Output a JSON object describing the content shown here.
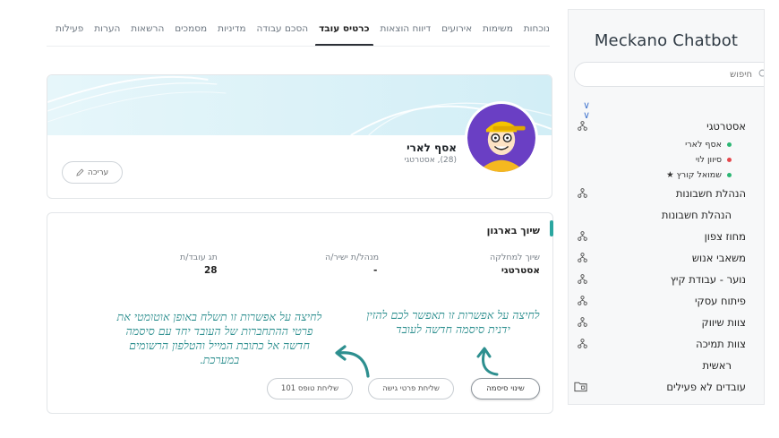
{
  "sidebar": {
    "title": "Meckano Chatbot",
    "search_placeholder": "חיפוש",
    "items": [
      {
        "label": "אסטרטגי",
        "type": "tree"
      },
      {
        "label": "אסף לארי",
        "type": "sub",
        "dot": "green"
      },
      {
        "label": "סיוון לוי",
        "type": "sub",
        "dot": "red"
      },
      {
        "label": "שמואל קורץ ★",
        "type": "sub",
        "dot": "green"
      },
      {
        "label": "הנהלת חשבונות",
        "type": "tree"
      },
      {
        "label": "הנהלת חשבונות",
        "type": "plain"
      },
      {
        "label": "מחוז צפון",
        "type": "tree"
      },
      {
        "label": "משאבי אנוש",
        "type": "tree"
      },
      {
        "label": "נוער - עבודת קיץ",
        "type": "tree"
      },
      {
        "label": "פיתוח עסקי",
        "type": "tree"
      },
      {
        "label": "צוות שיווק",
        "type": "tree"
      },
      {
        "label": "צוות תמיכה",
        "type": "tree"
      },
      {
        "label": "ראשית",
        "type": "plain"
      },
      {
        "label": "עובדים לא פעילים",
        "type": "folder"
      }
    ]
  },
  "tabs": [
    {
      "label": "נוכחות",
      "active": false
    },
    {
      "label": "משימות",
      "active": false
    },
    {
      "label": "אירועים",
      "active": false
    },
    {
      "label": "דיווח הוצאות",
      "active": false
    },
    {
      "label": "כרטיס עובד",
      "active": true
    },
    {
      "label": "הסכם עבודה",
      "active": false
    },
    {
      "label": "מדיניות",
      "active": false
    },
    {
      "label": "מסמכים",
      "active": false
    },
    {
      "label": "הרשאות",
      "active": false
    },
    {
      "label": "הערות",
      "active": false
    },
    {
      "label": "פעילות",
      "active": false
    }
  ],
  "profile": {
    "name": "אסף לארי",
    "subtitle": "(28), אסטרטגי",
    "edit_label": "עריכה"
  },
  "org": {
    "title": "שיוך בארגון",
    "fields": [
      {
        "label": "שיוך למחלקה",
        "value": "אסטרטגי"
      },
      {
        "label": "מנהל/ת ישיר/ה",
        "value": "-"
      },
      {
        "label": "תג עובד/ת",
        "value": "28"
      }
    ],
    "buttons": {
      "change_password": "שינוי סיסמה",
      "send_access": "שליחת פרטי גישה",
      "send_form": "שליחת טופס 101"
    },
    "notes": {
      "right": "לחיצה על אפשרות זו תאפשר לכם להזין ידנית סיסמה חדשה לעובד",
      "left": "לחיצה על אפשרות זו תשלח באופן אוטומטי את פרטי ההתחברות של העובד יחד עם סיסמה חדשה אל כתובת המייל והטלפון הרשומים במערכת."
    }
  },
  "colors": {
    "accent_teal": "#2aa6a0",
    "annotation": "#2d8f8f",
    "avatar_bg": "#6a3fc4",
    "banner": "#d9f1f8"
  }
}
